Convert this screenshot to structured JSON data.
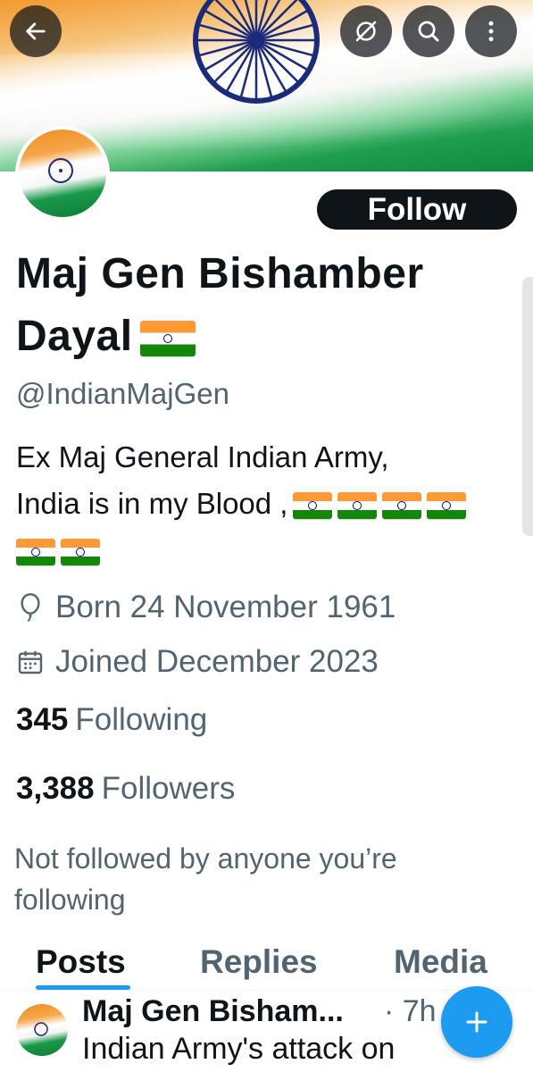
{
  "header": {
    "back_icon": "arrow-left-icon",
    "actions": [
      "no-sync-icon",
      "search-icon",
      "more-vertical-icon"
    ]
  },
  "profile": {
    "follow_label": "Follow",
    "name": "Maj Gen Bishamber Dayal",
    "handle": "@IndianMajGen",
    "bio_line1": "Ex Maj General Indian Army,",
    "bio_line2": "India is in my Blood ,",
    "born": "Born 24 November 1961",
    "joined": "Joined December 2023",
    "following_count": "345",
    "following_label": "Following",
    "followers_count": "3,388",
    "followers_label": "Followers",
    "not_followed": "Not followed by anyone you’re following"
  },
  "tabs": [
    {
      "label": "Posts",
      "active": true
    },
    {
      "label": "Replies",
      "active": false
    },
    {
      "label": "Media",
      "active": false
    }
  ],
  "post": {
    "author": "Maj Gen Bisham...",
    "time": "· 7h",
    "text": "Indian Army's attack on"
  },
  "colors": {
    "accent": "#1d9bf0",
    "text": "#0f1419",
    "secondary": "#536471",
    "saffron": "#ff9933",
    "green": "#138808"
  }
}
